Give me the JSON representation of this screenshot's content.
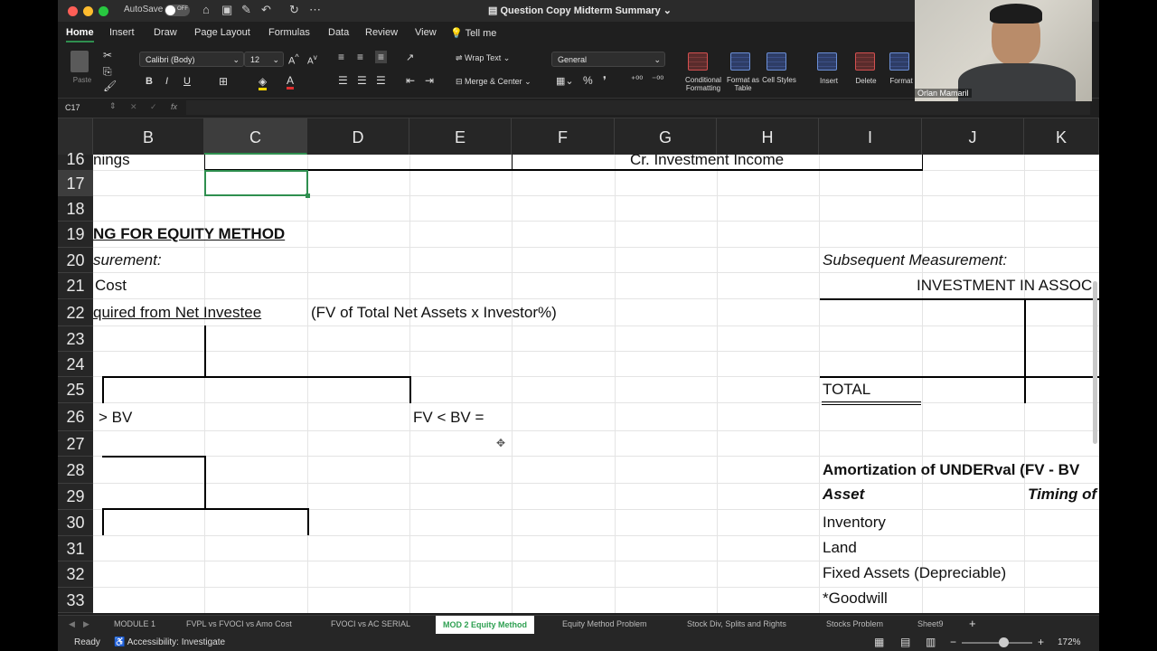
{
  "titlebar": {
    "autosave_label": "AutoSave",
    "autosave_state": "OFF",
    "doc_title": "Question Copy Midterm Summary"
  },
  "ribbon_tabs": [
    "Home",
    "Insert",
    "Draw",
    "Page Layout",
    "Formulas",
    "Data",
    "Review",
    "View",
    "Tell me"
  ],
  "ribbon": {
    "paste_label": "Paste",
    "font_name": "Calibri (Body)",
    "font_size": "12",
    "wrap_text": "Wrap Text",
    "merge_center": "Merge & Center",
    "number_format": "General",
    "conditional_formatting": "Conditional Formatting",
    "format_as_table": "Format as Table",
    "cell_styles": "Cell Styles",
    "insert": "Insert",
    "delete": "Delete",
    "format": "Format"
  },
  "formula_bar": {
    "name_box": "C17",
    "fx": "fx",
    "value": ""
  },
  "columns": [
    "B",
    "C",
    "D",
    "E",
    "F",
    "G",
    "H",
    "I",
    "J",
    "K"
  ],
  "rows": [
    "16",
    "17",
    "18",
    "19",
    "20",
    "21",
    "22",
    "23",
    "24",
    "25",
    "26",
    "27",
    "28",
    "29",
    "30",
    "31",
    "32",
    "33"
  ],
  "cells": {
    "b16": "nings",
    "g16": "Cr. Investment Income",
    "b19": "NG FOR EQUITY METHOD",
    "b20": "surement:",
    "i20": "Subsequent Measurement:",
    "b21": "Cost",
    "i21": "INVESTMENT IN ASSOC",
    "b22": "quired from Net Investee",
    "d22": "(FV of Total Net Assets x Investor%)",
    "i25": "TOTAL",
    "b26": "> BV",
    "e26": "FV < BV =",
    "i28": "Amortization of UNDERval (FV - BV",
    "i29": "Asset",
    "k29": "Timing of",
    "i30": "Inventory",
    "i31": "Land",
    "i32": "Fixed Assets (Depreciable)",
    "i33": "*Goodwill"
  },
  "sheets": [
    "MODULE 1",
    "FVPL vs FVOCI vs Amo Cost",
    "FVOCI vs AC SERIAL",
    "MOD 2 Equity Method",
    "Equity Method Problem",
    "Stock Div, Splits and Rights",
    "Stocks Problem",
    "Sheet9"
  ],
  "active_sheet": "MOD 2 Equity Method",
  "status": {
    "ready": "Ready",
    "accessibility": "Accessibility: Investigate",
    "zoom": "172%"
  },
  "webcam": {
    "name": "Orlan Mamaril"
  },
  "colors": {
    "accent": "#2f8f4f",
    "grid": "#e4e4e4"
  }
}
